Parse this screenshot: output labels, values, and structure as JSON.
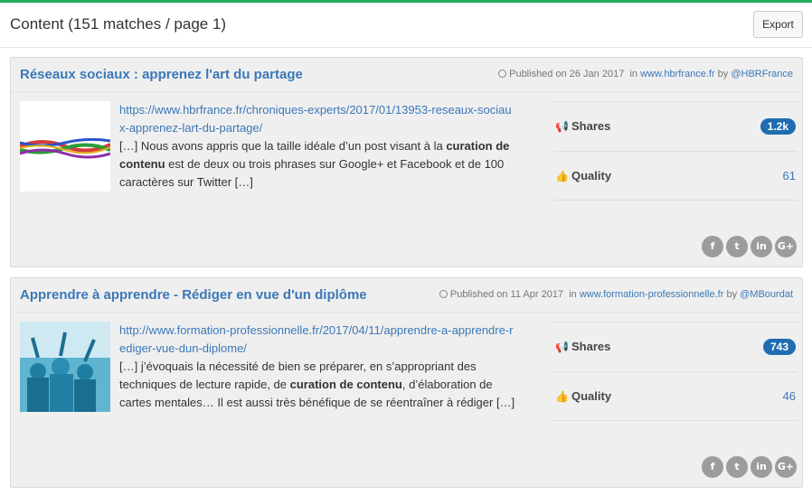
{
  "header": {
    "title": "Content (151 matches / page 1)",
    "export_label": "Export"
  },
  "colors": {
    "accent_bar": "#27ae60",
    "link": "#3b78b8",
    "badge": "#1f6db0"
  },
  "cards": [
    {
      "title": "Réseaux sociaux : apprenez l'art du partage",
      "published": "Published on 26 Jan 2017",
      "in_label": "in",
      "site": "www.hbrfrance.fr",
      "by_label": "by",
      "author": "@HBRFrance",
      "url": "https://www.hbrfrance.fr/chroniques-experts/2017/01/13953-reseaux-sociaux-apprenez-lart-du-partage/",
      "snippet_pre": "[…] Nous avons appris que la taille idéale d’un post visant à la ",
      "snippet_bold": "curation de contenu",
      "snippet_post": " est de deux ou trois phrases sur Google+ et Facebook et de 100 caractères sur Twitter […]",
      "shares_label": "Shares",
      "shares_value": "1.2k",
      "quality_label": "Quality",
      "quality_value": "61"
    },
    {
      "title": "Apprendre à apprendre - Rédiger en vue d'un diplôme",
      "published": "Published on 11 Apr 2017",
      "in_label": "in",
      "site": "www.formation-professionnelle.fr",
      "by_label": "by",
      "author": "@MBourdat",
      "url": "http://www.formation-professionnelle.fr/2017/04/11/apprendre-a-apprendre-rediger-vue-dun-diplome/",
      "snippet_pre": "[…] j’évoquais la nécessité de bien se préparer, en s’appropriant des techniques de lecture rapide, de ",
      "snippet_bold": "curation de contenu",
      "snippet_post": ", d’élaboration de cartes mentales… Il est aussi très bénéfique de se réentraîner à rédiger […]",
      "shares_label": "Shares",
      "shares_value": "743",
      "quality_label": "Quality",
      "quality_value": "46"
    }
  ],
  "socials": {
    "facebook": "f",
    "twitter": "t",
    "linkedin": "in",
    "googleplus": "G+"
  }
}
